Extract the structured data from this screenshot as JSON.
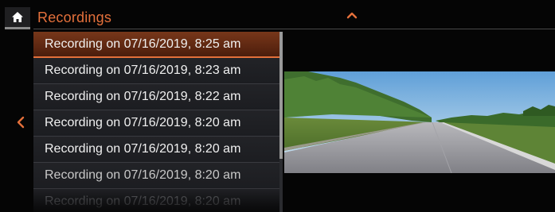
{
  "header": {
    "title": "Recordings",
    "home_icon": "home-icon",
    "collapse_icon": "chevron-up-icon"
  },
  "nav": {
    "back_icon": "chevron-left-icon"
  },
  "recordings": {
    "items": [
      {
        "label": "Recording on 07/16/2019, 8:25 am",
        "selected": true
      },
      {
        "label": "Recording on 07/16/2019, 8:23 am",
        "selected": false
      },
      {
        "label": "Recording on 07/16/2019, 8:22 am",
        "selected": false
      },
      {
        "label": "Recording on 07/16/2019, 8:20 am",
        "selected": false
      },
      {
        "label": "Recording on 07/16/2019, 8:20 am",
        "selected": false
      },
      {
        "label": "Recording on 07/16/2019, 8:20 am",
        "selected": false
      },
      {
        "label": "Recording on 07/16/2019, 8:20 am",
        "selected": false
      }
    ]
  },
  "colors": {
    "accent": "#e4703b",
    "selected_bg": "#5a2510",
    "list_bg": "#1d1e22",
    "background": "#050505"
  }
}
